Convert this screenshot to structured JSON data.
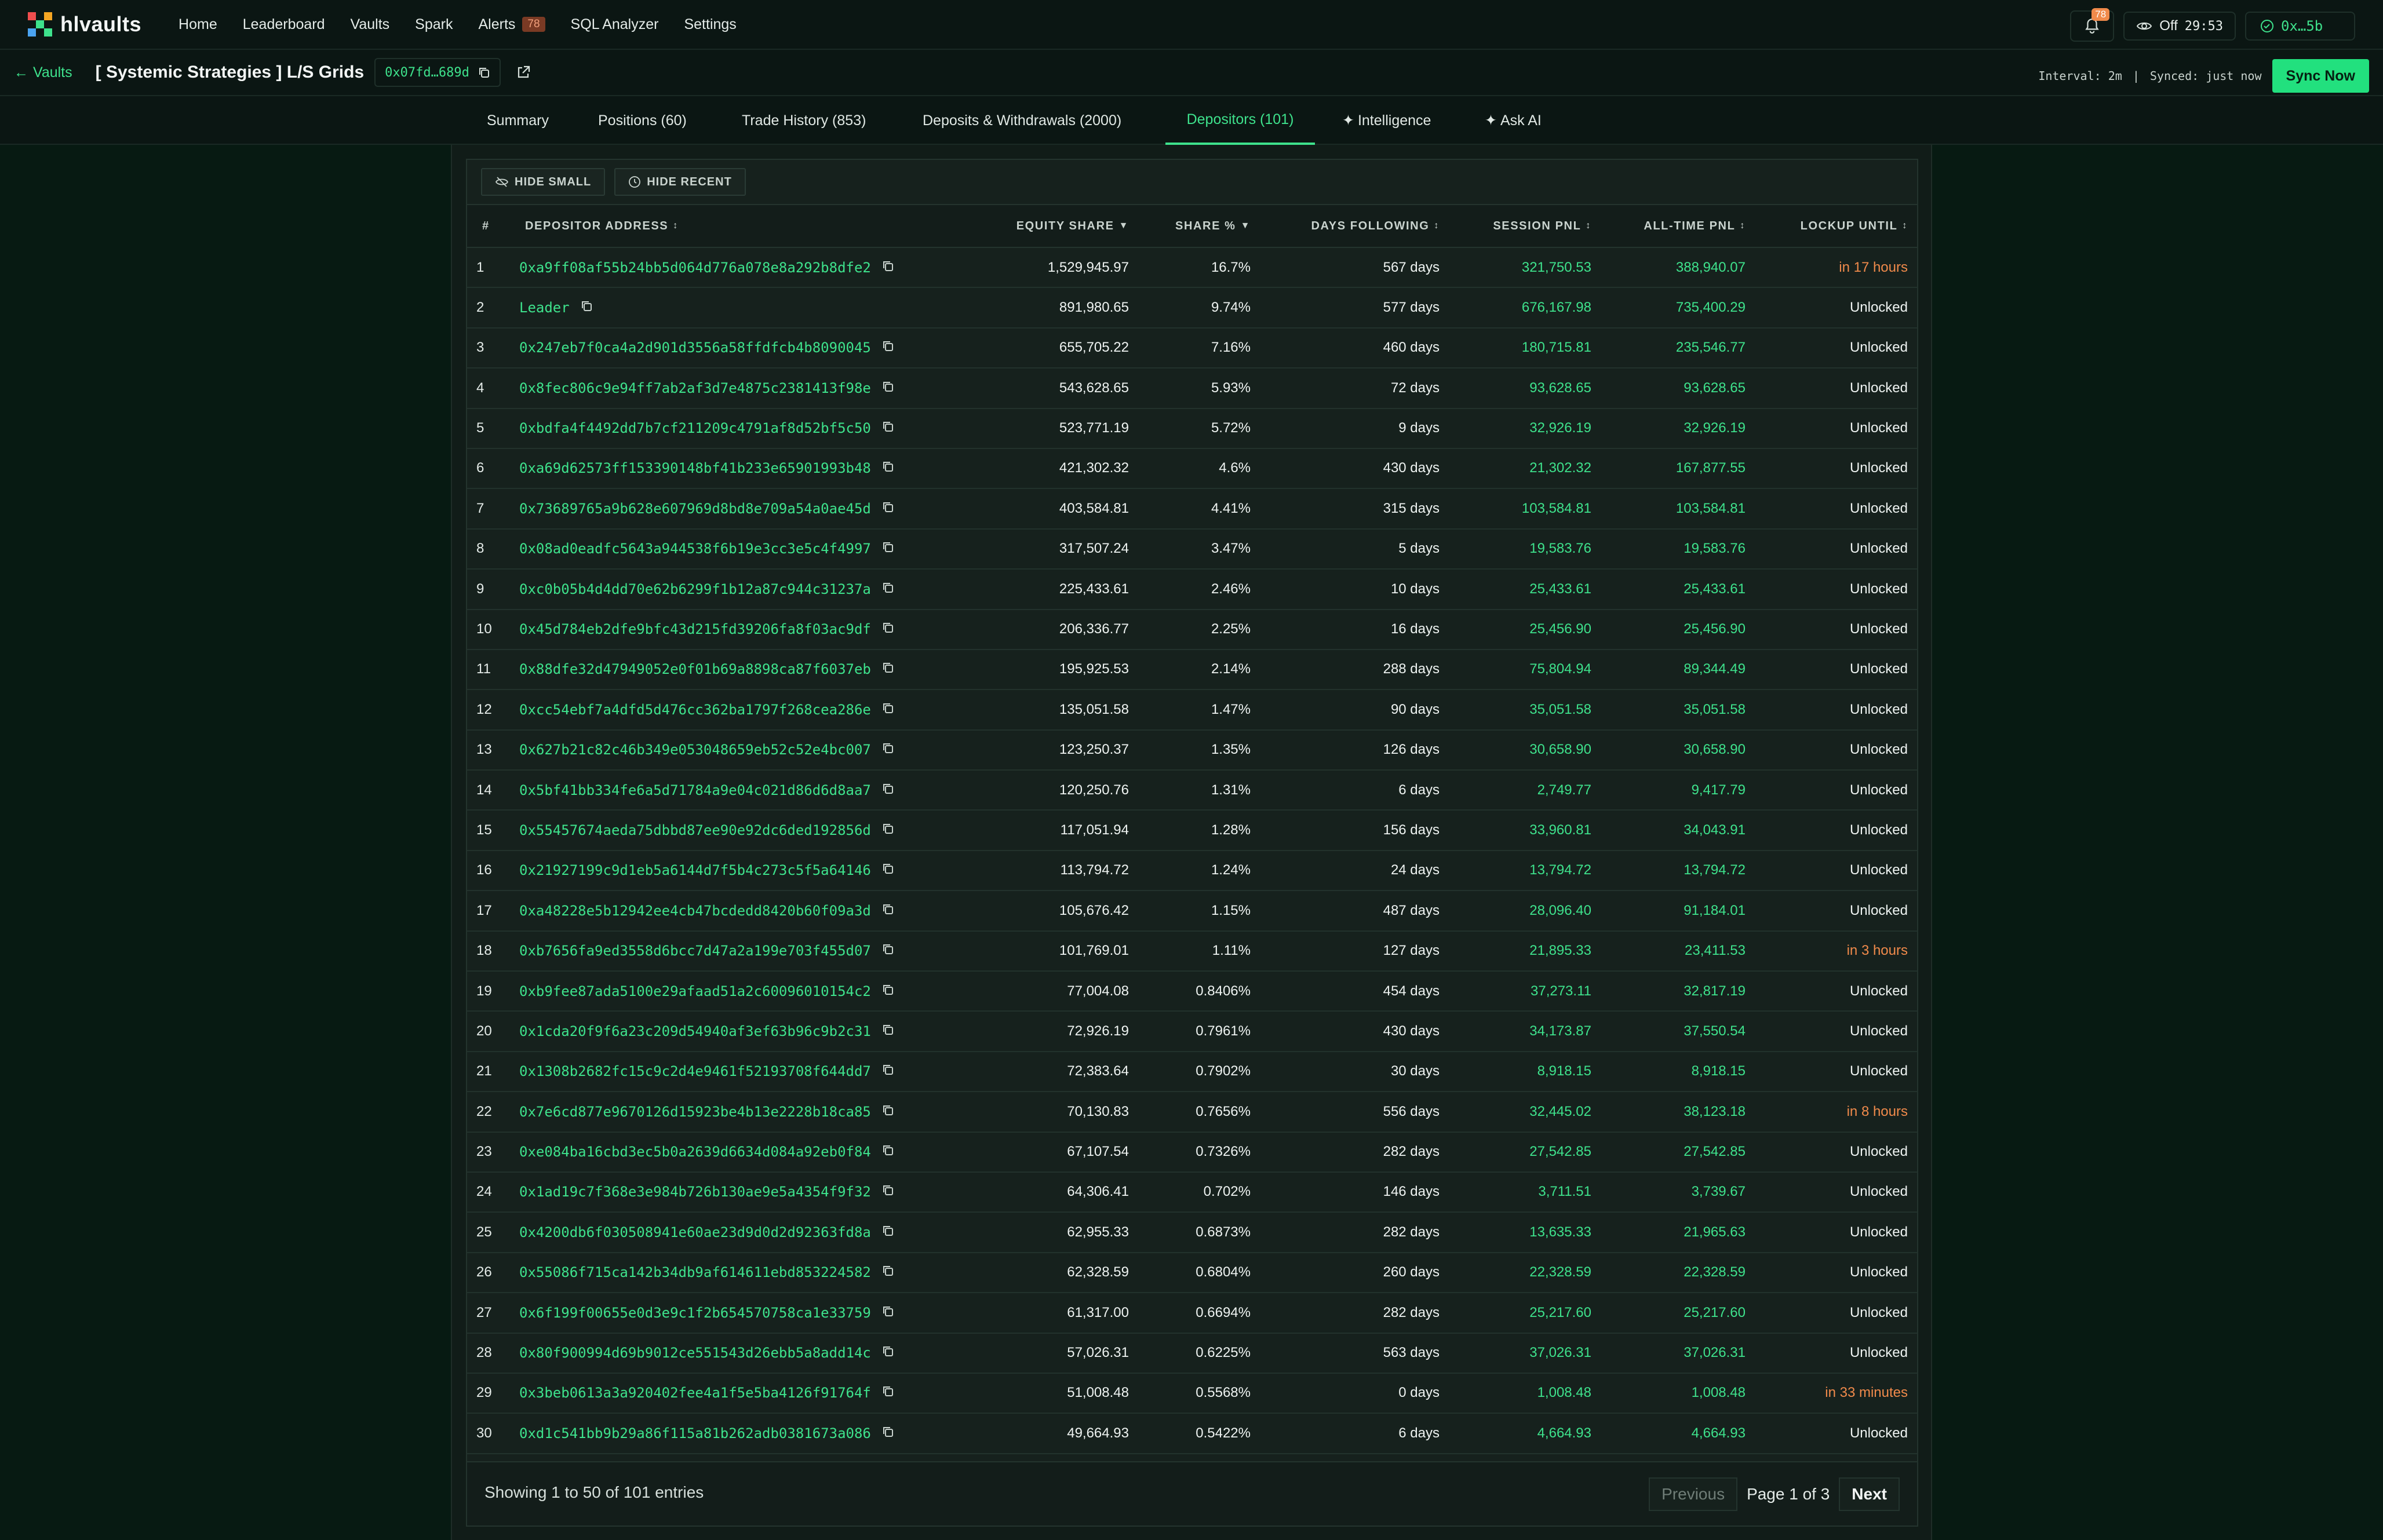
{
  "app": {
    "name": "hlvaults",
    "brand_colors": [
      "#f04e4e",
      "#f5a623",
      "#3ee28c",
      "#4aa3f0"
    ]
  },
  "nav": {
    "items": [
      {
        "label": "Home"
      },
      {
        "label": "Leaderboard"
      },
      {
        "label": "Vaults"
      },
      {
        "label": "Spark"
      },
      {
        "label": "Alerts",
        "badge": "78"
      },
      {
        "label": "SQL Analyzer"
      },
      {
        "label": "Settings"
      }
    ]
  },
  "top_right": {
    "bell_badge": "78",
    "privacy_label": "Off",
    "timer": "29:53",
    "wallet": "0x…5b"
  },
  "vault": {
    "back_label": "Vaults",
    "title": "[ Systemic Strategies ] L/S Grids",
    "address_short": "0x07fd…689d",
    "interval": "Interval: 2m",
    "separator": "|",
    "synced": "Synced: just now",
    "sync_button": "Sync Now"
  },
  "tabs": [
    {
      "label": "Summary"
    },
    {
      "label": "Positions (60)"
    },
    {
      "label": "Trade History (853)"
    },
    {
      "label": "Deposits & Withdrawals (2000)"
    },
    {
      "label": "Depositors (101)",
      "active": true
    },
    {
      "label": "Intelligence"
    },
    {
      "label": "Ask AI"
    }
  ],
  "filters": {
    "hide_small": "HIDE SMALL",
    "hide_recent": "HIDE RECENT"
  },
  "table": {
    "columns": {
      "idx": "#",
      "address": "DEPOSITOR ADDRESS",
      "equity": "EQUITY SHARE",
      "share": "SHARE %",
      "days": "DAYS FOLLOWING",
      "session": "SESSION PNL",
      "alltime": "ALL-TIME PNL",
      "lockup": "LOCKUP UNTIL"
    },
    "rows": [
      {
        "idx": "1",
        "address": "0xa9ff08af55b24bb5d064d776a078e8a292b8dfe2",
        "equity": "1,529,945.97",
        "share": "16.7%",
        "days": "567 days",
        "session": "321,750.53",
        "alltime": "388,940.07",
        "lockup": "in 17 hours",
        "locked": true
      },
      {
        "idx": "2",
        "address": "Leader",
        "equity": "891,980.65",
        "share": "9.74%",
        "days": "577 days",
        "session": "676,167.98",
        "alltime": "735,400.29",
        "lockup": "Unlocked",
        "locked": false
      },
      {
        "idx": "3",
        "address": "0x247eb7f0ca4a2d901d3556a58ffdfcb4b8090045",
        "equity": "655,705.22",
        "share": "7.16%",
        "days": "460 days",
        "session": "180,715.81",
        "alltime": "235,546.77",
        "lockup": "Unlocked",
        "locked": false
      },
      {
        "idx": "4",
        "address": "0x8fec806c9e94ff7ab2af3d7e4875c2381413f98e",
        "equity": "543,628.65",
        "share": "5.93%",
        "days": "72 days",
        "session": "93,628.65",
        "alltime": "93,628.65",
        "lockup": "Unlocked",
        "locked": false
      },
      {
        "idx": "5",
        "address": "0xbdfa4f4492dd7b7cf211209c4791af8d52bf5c50",
        "equity": "523,771.19",
        "share": "5.72%",
        "days": "9 days",
        "session": "32,926.19",
        "alltime": "32,926.19",
        "lockup": "Unlocked",
        "locked": false
      },
      {
        "idx": "6",
        "address": "0xa69d62573ff153390148bf41b233e65901993b48",
        "equity": "421,302.32",
        "share": "4.6%",
        "days": "430 days",
        "session": "21,302.32",
        "alltime": "167,877.55",
        "lockup": "Unlocked",
        "locked": false
      },
      {
        "idx": "7",
        "address": "0x73689765a9b628e607969d8bd8e709a54a0ae45d",
        "equity": "403,584.81",
        "share": "4.41%",
        "days": "315 days",
        "session": "103,584.81",
        "alltime": "103,584.81",
        "lockup": "Unlocked",
        "locked": false
      },
      {
        "idx": "8",
        "address": "0x08ad0eadfc5643a944538f6b19e3cc3e5c4f4997",
        "equity": "317,507.24",
        "share": "3.47%",
        "days": "5 days",
        "session": "19,583.76",
        "alltime": "19,583.76",
        "lockup": "Unlocked",
        "locked": false
      },
      {
        "idx": "9",
        "address": "0xc0b05b4d4dd70e62b6299f1b12a87c944c31237a",
        "equity": "225,433.61",
        "share": "2.46%",
        "days": "10 days",
        "session": "25,433.61",
        "alltime": "25,433.61",
        "lockup": "Unlocked",
        "locked": false
      },
      {
        "idx": "10",
        "address": "0x45d784eb2dfe9bfc43d215fd39206fa8f03ac9df",
        "equity": "206,336.77",
        "share": "2.25%",
        "days": "16 days",
        "session": "25,456.90",
        "alltime": "25,456.90",
        "lockup": "Unlocked",
        "locked": false
      },
      {
        "idx": "11",
        "address": "0x88dfe32d47949052e0f01b69a8898ca87f6037eb",
        "equity": "195,925.53",
        "share": "2.14%",
        "days": "288 days",
        "session": "75,804.94",
        "alltime": "89,344.49",
        "lockup": "Unlocked",
        "locked": false
      },
      {
        "idx": "12",
        "address": "0xcc54ebf7a4dfd5d476cc362ba1797f268cea286e",
        "equity": "135,051.58",
        "share": "1.47%",
        "days": "90 days",
        "session": "35,051.58",
        "alltime": "35,051.58",
        "lockup": "Unlocked",
        "locked": false
      },
      {
        "idx": "13",
        "address": "0x627b21c82c46b349e053048659eb52c52e4bc007",
        "equity": "123,250.37",
        "share": "1.35%",
        "days": "126 days",
        "session": "30,658.90",
        "alltime": "30,658.90",
        "lockup": "Unlocked",
        "locked": false
      },
      {
        "idx": "14",
        "address": "0x5bf41bb334fe6a5d71784a9e04c021d86d6d8aa7",
        "equity": "120,250.76",
        "share": "1.31%",
        "days": "6 days",
        "session": "2,749.77",
        "alltime": "9,417.79",
        "lockup": "Unlocked",
        "locked": false
      },
      {
        "idx": "15",
        "address": "0x55457674aeda75dbbd87ee90e92dc6ded192856d",
        "equity": "117,051.94",
        "share": "1.28%",
        "days": "156 days",
        "session": "33,960.81",
        "alltime": "34,043.91",
        "lockup": "Unlocked",
        "locked": false
      },
      {
        "idx": "16",
        "address": "0x21927199c9d1eb5a6144d7f5b4c273c5f5a64146",
        "equity": "113,794.72",
        "share": "1.24%",
        "days": "24 days",
        "session": "13,794.72",
        "alltime": "13,794.72",
        "lockup": "Unlocked",
        "locked": false
      },
      {
        "idx": "17",
        "address": "0xa48228e5b12942ee4cb47bcdedd8420b60f09a3d",
        "equity": "105,676.42",
        "share": "1.15%",
        "days": "487 days",
        "session": "28,096.40",
        "alltime": "91,184.01",
        "lockup": "Unlocked",
        "locked": false
      },
      {
        "idx": "18",
        "address": "0xb7656fa9ed3558d6bcc7d47a2a199e703f455d07",
        "equity": "101,769.01",
        "share": "1.11%",
        "days": "127 days",
        "session": "21,895.33",
        "alltime": "23,411.53",
        "lockup": "in 3 hours",
        "locked": true
      },
      {
        "idx": "19",
        "address": "0xb9fee87ada5100e29afaad51a2c60096010154c2",
        "equity": "77,004.08",
        "share": "0.8406%",
        "days": "454 days",
        "session": "37,273.11",
        "alltime": "32,817.19",
        "lockup": "Unlocked",
        "locked": false
      },
      {
        "idx": "20",
        "address": "0x1cda20f9f6a23c209d54940af3ef63b96c9b2c31",
        "equity": "72,926.19",
        "share": "0.7961%",
        "days": "430 days",
        "session": "34,173.87",
        "alltime": "37,550.54",
        "lockup": "Unlocked",
        "locked": false
      },
      {
        "idx": "21",
        "address": "0x1308b2682fc15c9c2d4e9461f52193708f644dd7",
        "equity": "72,383.64",
        "share": "0.7902%",
        "days": "30 days",
        "session": "8,918.15",
        "alltime": "8,918.15",
        "lockup": "Unlocked",
        "locked": false
      },
      {
        "idx": "22",
        "address": "0x7e6cd877e9670126d15923be4b13e2228b18ca85",
        "equity": "70,130.83",
        "share": "0.7656%",
        "days": "556 days",
        "session": "32,445.02",
        "alltime": "38,123.18",
        "lockup": "in 8 hours",
        "locked": true
      },
      {
        "idx": "23",
        "address": "0xe084ba16cbd3ec5b0a2639d6634d084a92eb0f84",
        "equity": "67,107.54",
        "share": "0.7326%",
        "days": "282 days",
        "session": "27,542.85",
        "alltime": "27,542.85",
        "lockup": "Unlocked",
        "locked": false
      },
      {
        "idx": "24",
        "address": "0x1ad19c7f368e3e984b726b130ae9e5a4354f9f32",
        "equity": "64,306.41",
        "share": "0.702%",
        "days": "146 days",
        "session": "3,711.51",
        "alltime": "3,739.67",
        "lockup": "Unlocked",
        "locked": false
      },
      {
        "idx": "25",
        "address": "0x4200db6f030508941e60ae23d9d0d2d92363fd8a",
        "equity": "62,955.33",
        "share": "0.6873%",
        "days": "282 days",
        "session": "13,635.33",
        "alltime": "21,965.63",
        "lockup": "Unlocked",
        "locked": false
      },
      {
        "idx": "26",
        "address": "0x55086f715ca142b34db9af614611ebd853224582",
        "equity": "62,328.59",
        "share": "0.6804%",
        "days": "260 days",
        "session": "22,328.59",
        "alltime": "22,328.59",
        "lockup": "Unlocked",
        "locked": false
      },
      {
        "idx": "27",
        "address": "0x6f199f00655e0d3e9c1f2b654570758ca1e33759",
        "equity": "61,317.00",
        "share": "0.6694%",
        "days": "282 days",
        "session": "25,217.60",
        "alltime": "25,217.60",
        "lockup": "Unlocked",
        "locked": false
      },
      {
        "idx": "28",
        "address": "0x80f900994d69b9012ce551543d26ebb5a8add14c",
        "equity": "57,026.31",
        "share": "0.6225%",
        "days": "563 days",
        "session": "37,026.31",
        "alltime": "37,026.31",
        "lockup": "Unlocked",
        "locked": false
      },
      {
        "idx": "29",
        "address": "0x3beb0613a3a920402fee4a1f5e5ba4126f91764f",
        "equity": "51,008.48",
        "share": "0.5568%",
        "days": "0 days",
        "session": "1,008.48",
        "alltime": "1,008.48",
        "lockup": "in 33 minutes",
        "locked": true
      },
      {
        "idx": "30",
        "address": "0xd1c541bb9b29a86f115a81b262adb0381673a086",
        "equity": "49,664.93",
        "share": "0.5422%",
        "days": "6 days",
        "session": "4,664.93",
        "alltime": "4,664.93",
        "lockup": "Unlocked",
        "locked": false
      }
    ]
  },
  "footer": {
    "showing": "Showing 1 to 50 of 101 entries",
    "previous": "Previous",
    "page_info": "Page 1 of 3",
    "next": "Next"
  }
}
